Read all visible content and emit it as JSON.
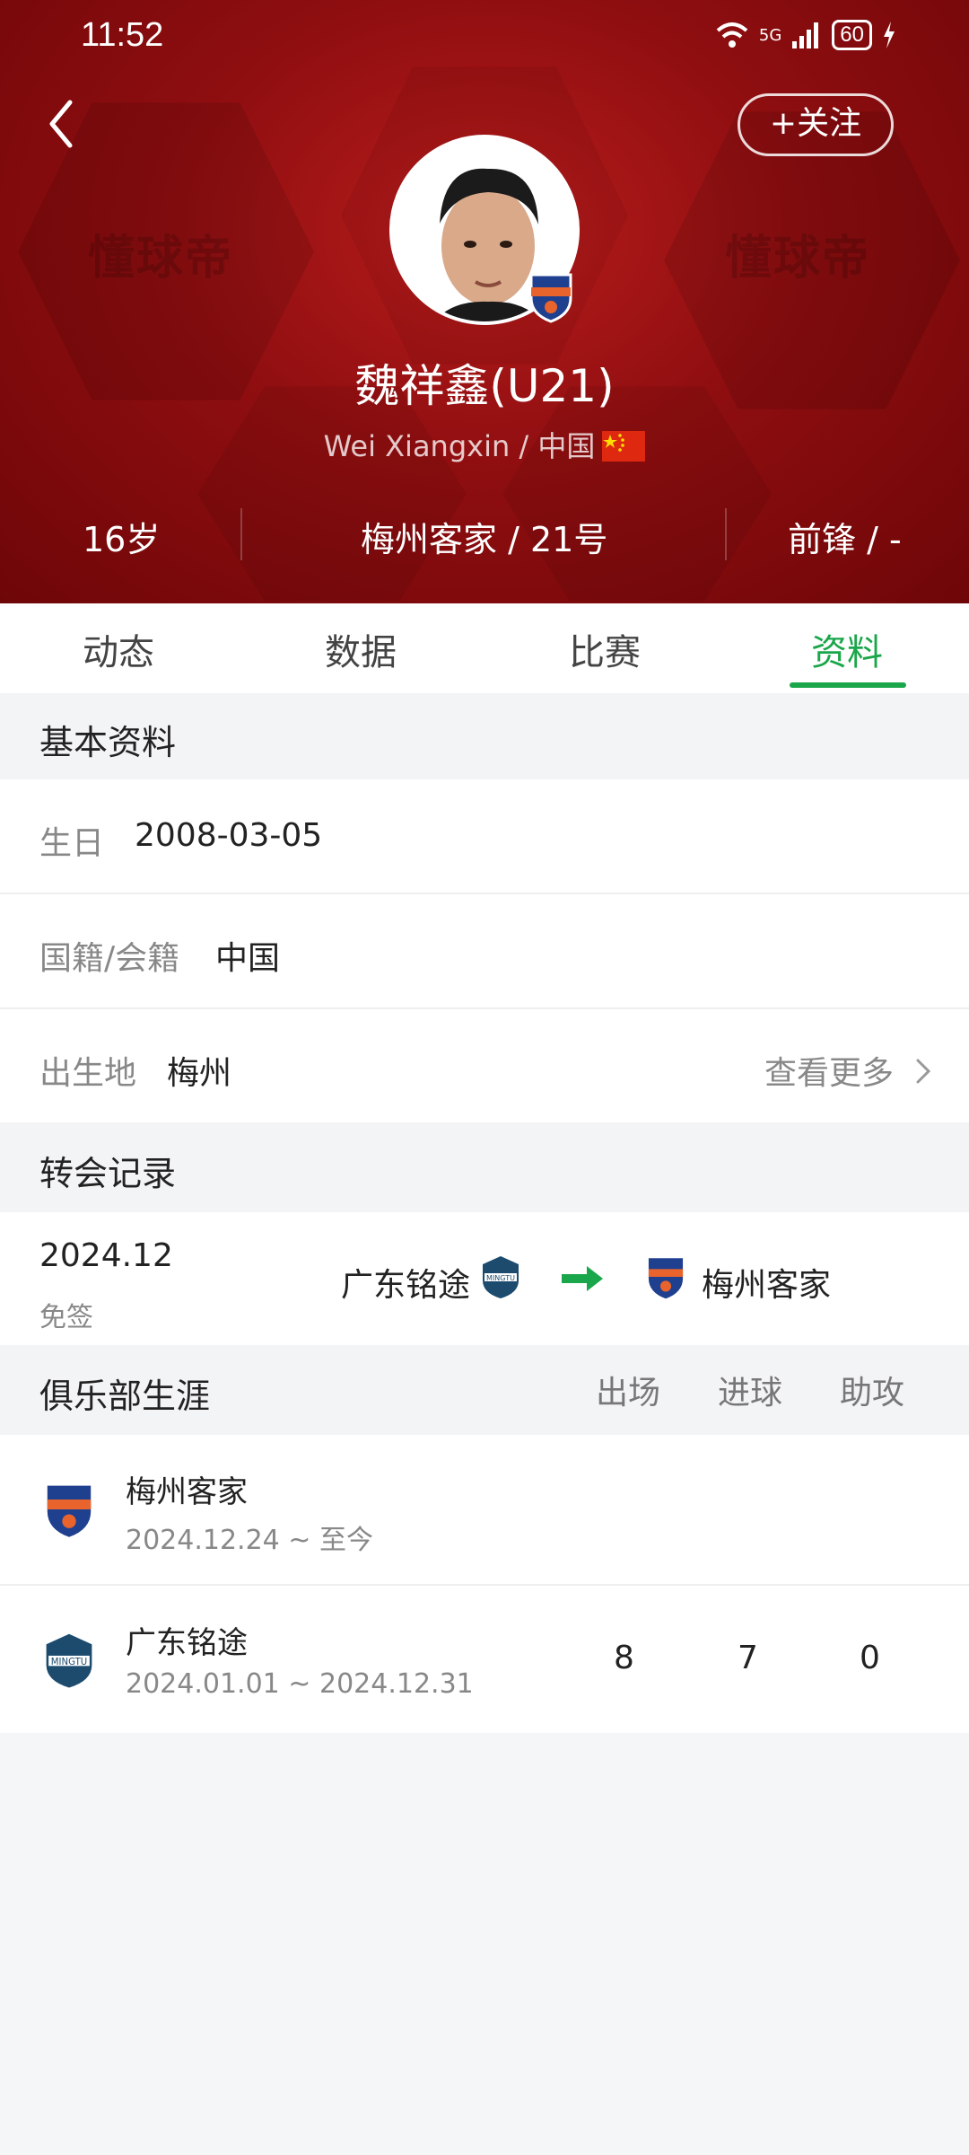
{
  "status_bar": {
    "time": "11:52",
    "network": "5G",
    "battery": "60"
  },
  "header": {
    "follow_label": "+关注",
    "watermark": "懂球帝",
    "player_name": "魏祥鑫(U21)",
    "player_subline": "Wei Xiangxin / 中国",
    "age": "16岁",
    "club_number": "梅州客家 / 21号",
    "position": "前锋 / -"
  },
  "tabs": [
    {
      "label": "动态"
    },
    {
      "label": "数据"
    },
    {
      "label": "比赛"
    },
    {
      "label": "资料",
      "active": true
    }
  ],
  "basic_info": {
    "title": "基本资料",
    "birthday_label": "生日",
    "birthday_value": "2008-03-05",
    "nationality_label": "国籍/会籍",
    "nationality_value": "中国",
    "birthplace_label": "出生地",
    "birthplace_value": "梅州",
    "see_more": "查看更多"
  },
  "transfers": {
    "title": "转会记录",
    "items": [
      {
        "date": "2024.12",
        "type": "免签",
        "from": "广东铭途",
        "to": "梅州客家"
      }
    ]
  },
  "career": {
    "title": "俱乐部生涯",
    "columns": [
      "出场",
      "进球",
      "助攻"
    ],
    "rows": [
      {
        "club": "梅州客家",
        "period": "2024.12.24 ~ 至今",
        "apps": "",
        "goals": "",
        "assists": ""
      },
      {
        "club": "广东铭途",
        "period": "2024.01.01 ~ 2024.12.31",
        "apps": "8",
        "goals": "7",
        "assists": "0"
      }
    ]
  },
  "colors": {
    "header_red": "#8f0e10",
    "accent_green": "#1aa64a"
  }
}
